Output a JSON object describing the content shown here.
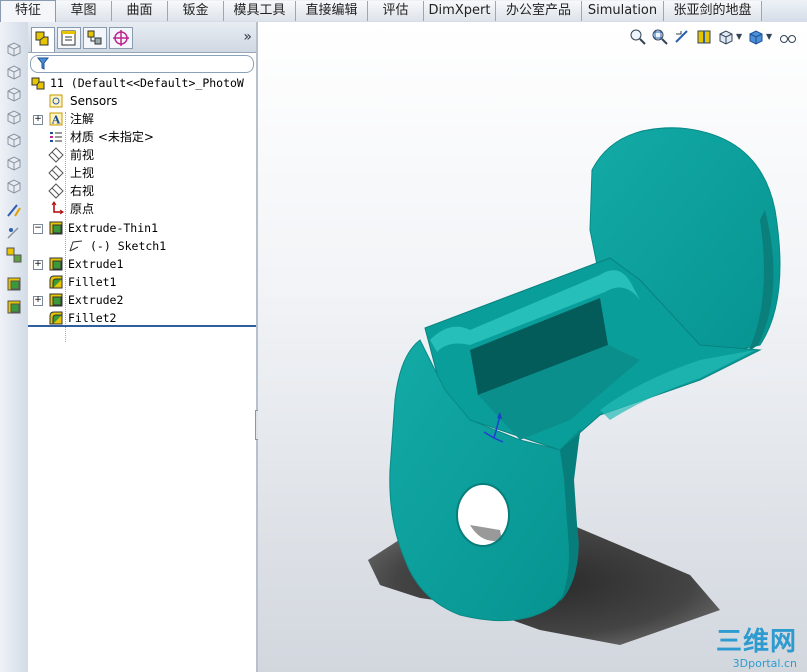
{
  "tabs": [
    "特征",
    "草图",
    "曲面",
    "钣金",
    "模具工具",
    "直接编辑",
    "评估",
    "DimXpert",
    "办公室产品",
    "Simulation",
    "张亚剑的地盘"
  ],
  "active_tab": "特征",
  "panel": {
    "expand_label": "»",
    "tree": {
      "root": "11  (Default<<Default>_PhotoW",
      "items": [
        {
          "label": "Sensors",
          "icon": "sensors-icon"
        },
        {
          "label": "注解",
          "icon": "annotations-icon",
          "expandable": true
        },
        {
          "label": "材质 <未指定>",
          "icon": "material-icon"
        },
        {
          "label": "前视",
          "icon": "plane-icon"
        },
        {
          "label": "上视",
          "icon": "plane-icon"
        },
        {
          "label": "右视",
          "icon": "plane-icon"
        },
        {
          "label": "原点",
          "icon": "origin-icon"
        },
        {
          "label": "Extrude-Thin1",
          "icon": "extrude-icon",
          "expanded": true
        },
        {
          "label": "(-) Sketch1",
          "icon": "sketch-icon",
          "child": true
        },
        {
          "label": "Extrude1",
          "icon": "extrude-icon",
          "expandable": true
        },
        {
          "label": "Fillet1",
          "icon": "fillet-icon"
        },
        {
          "label": "Extrude2",
          "icon": "extrude-icon",
          "expandable": true
        },
        {
          "label": "Fillet2",
          "icon": "fillet-icon"
        }
      ]
    }
  },
  "viewport": {
    "toolbar_icons": [
      "zoom-to-fit-icon",
      "zoom-to-area-icon",
      "previous-view-icon",
      "section-view-icon",
      "view-orientation-icon",
      "display-style-icon",
      "hide-show-icon"
    ],
    "watermark_main": "三维网",
    "watermark_sub": "3Dportal.cn"
  },
  "colors": {
    "part": "#0a9b98",
    "part_dark": "#05706e",
    "part_light": "#2dc2bd",
    "shadow": "#3c3c3c"
  }
}
